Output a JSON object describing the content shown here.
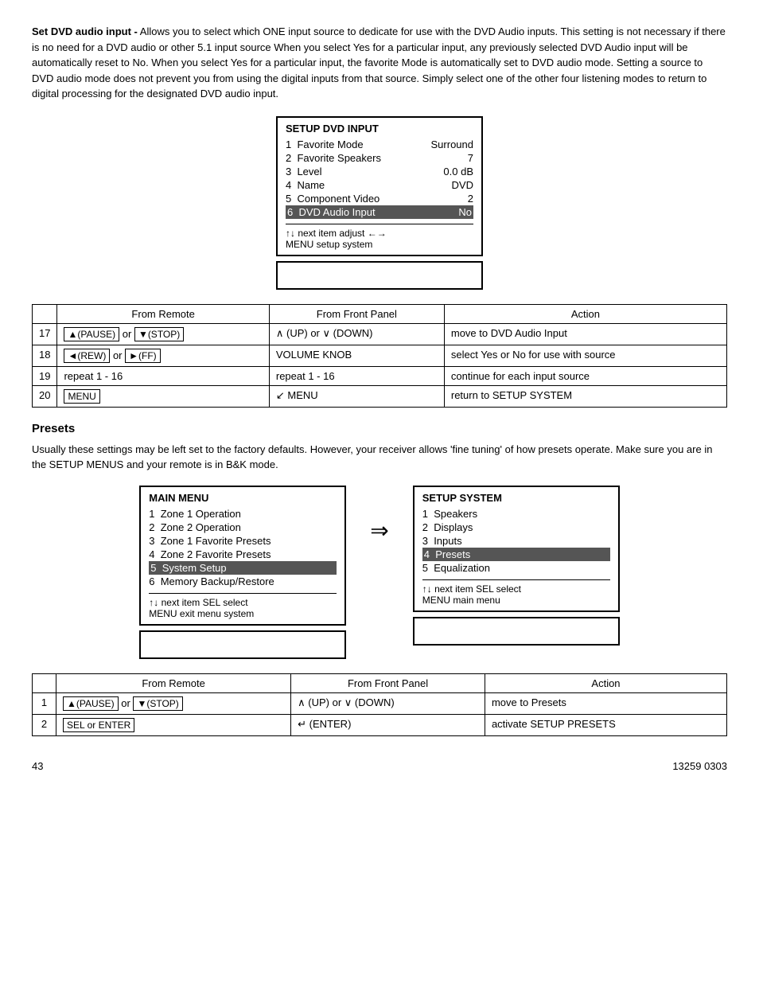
{
  "intro": {
    "bold_prefix": "Set DVD audio input -",
    "text": " Allows you to select which ONE input source to dedicate for use with the DVD Audio inputs. This setting is not necessary if there is no need for a DVD audio or other 5.1 input source When you select Yes for a particular input, any previously selected DVD Audio input will be automatically reset to No. When you select Yes for a particular input, the favorite Mode is automatically set to DVD audio mode. Setting a source to DVD audio mode does not prevent you from using the digital inputs from that source. Simply select one of the other four listening modes to return to digital processing for the designated DVD audio input."
  },
  "dvd_menu": {
    "title": "SETUP DVD   INPUT",
    "rows": [
      {
        "num": "1",
        "label": "Favorite Mode",
        "value": "Surround"
      },
      {
        "num": "2",
        "label": "Favorite Speakers",
        "value": "7"
      },
      {
        "num": "3",
        "label": "Level",
        "value": "0.0 dB"
      },
      {
        "num": "4",
        "label": "Name",
        "value": "DVD"
      },
      {
        "num": "5",
        "label": "Component Video",
        "value": "2"
      },
      {
        "num": "6",
        "label": "DVD Audio Input",
        "value": "No",
        "highlighted": true
      }
    ],
    "nav_line1": "↑↓  next item       adjust  ←→",
    "nav_line2": "MENU setup system"
  },
  "dvd_table": {
    "headers": [
      "",
      "From Remote",
      "From Front Panel",
      "Action"
    ],
    "rows": [
      {
        "num": "17",
        "remote": "▲(PAUSE) or ▼(STOP)",
        "panel": "∧ (UP) or ∨ (DOWN)",
        "action": "move to DVD Audio Input",
        "remote_boxed": true
      },
      {
        "num": "18",
        "remote": "◄(REW) or ►(FF)",
        "panel": "VOLUME KNOB",
        "action": "select  Yes or No for use with source",
        "remote_boxed": true
      },
      {
        "num": "19",
        "remote": "repeat 1 - 16",
        "panel": "repeat 1 - 16",
        "action": "continue for each input source",
        "remote_boxed": false
      },
      {
        "num": "20",
        "remote": "MENU",
        "panel": "↙ MENU",
        "action": "return to SETUP SYSTEM",
        "remote_boxed": true
      }
    ]
  },
  "presets_section": {
    "heading": "Presets",
    "text": "Usually these settings may be left set to the factory defaults. However, your receiver allows 'fine tuning' of how presets operate. Make sure you are in the SETUP MENUS and your remote is in B&K mode."
  },
  "main_menu": {
    "title": "MAIN MENU",
    "rows": [
      {
        "num": "1",
        "label": "Zone 1 Operation",
        "highlighted": false
      },
      {
        "num": "2",
        "label": "Zone 2 Operation",
        "highlighted": false
      },
      {
        "num": "3",
        "label": "Zone 1 Favorite Presets",
        "highlighted": false
      },
      {
        "num": "4",
        "label": "Zone 2 Favorite Presets",
        "highlighted": false
      },
      {
        "num": "5",
        "label": "System Setup",
        "highlighted": true
      },
      {
        "num": "6",
        "label": "Memory Backup/Restore",
        "highlighted": false
      }
    ],
    "nav_line1": "↑↓ next item       SEL  select",
    "nav_line2": "MENU    exit menu system"
  },
  "setup_system_menu": {
    "title": "SETUP SYSTEM",
    "rows": [
      {
        "num": "1",
        "label": "Speakers",
        "highlighted": false
      },
      {
        "num": "2",
        "label": "Displays",
        "highlighted": false
      },
      {
        "num": "3",
        "label": "Inputs",
        "highlighted": false
      },
      {
        "num": "4",
        "label": "Presets",
        "highlighted": true
      },
      {
        "num": "5",
        "label": "Equalization",
        "highlighted": false
      }
    ],
    "nav_line1": "↑↓   next item       SEL  select",
    "nav_line2": "MENU  main menu"
  },
  "presets_table": {
    "headers": [
      "",
      "From Remote",
      "From Front Panel",
      "Action"
    ],
    "rows": [
      {
        "num": "1",
        "remote": "▲(PAUSE) or ▼(STOP)",
        "panel": "∧ (UP) or ∨ (DOWN)",
        "action": "move to Presets",
        "remote_boxed": true
      },
      {
        "num": "2",
        "remote": "SEL or ENTER",
        "panel": "↵ (ENTER)",
        "action": "activate SETUP PRESETS",
        "remote_boxed": true
      }
    ]
  },
  "footer": {
    "page_num": "43",
    "doc_num": "13259 0303"
  }
}
